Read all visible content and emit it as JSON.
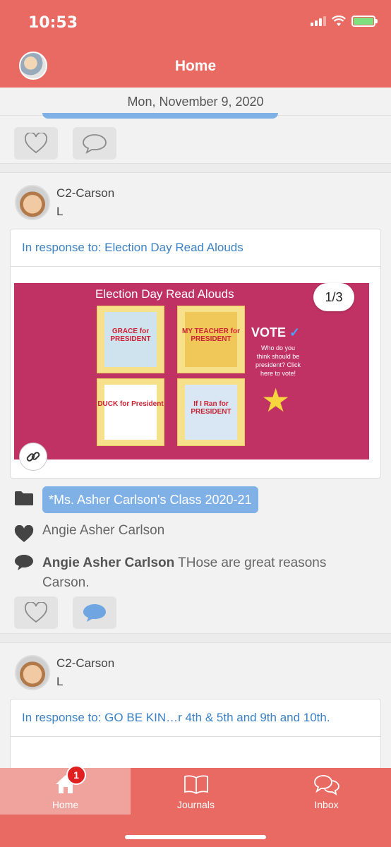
{
  "status": {
    "time": "10:53"
  },
  "header": {
    "title": "Home"
  },
  "date": "Mon, November 9, 2020",
  "posts": [
    {
      "author": "C2-Carson",
      "author_sub": "L",
      "response_to": "In response to: Election Day Read Alouds",
      "image": {
        "title": "Election Day Read Alouds",
        "books": [
          "GRACE for PRESIDENT",
          "MY TEACHER for PRESIDENT",
          "DUCK for President",
          "If I Ran for PRESIDENT"
        ],
        "vote_label": "VOTE",
        "vote_text": "Who do you think should be president? Click here to vote!",
        "counter": "1/3"
      },
      "class_tag": "*Ms. Asher Carlson's Class 2020-21",
      "liked_by": "Angie Asher Carlson",
      "comment": {
        "author": "Angie Asher Carlson",
        "text": "THose are great reasons Carson."
      }
    },
    {
      "author": "C2-Carson",
      "author_sub": "L",
      "response_to": "In response to: GO BE KIN…r 4th & 5th and 9th and 10th."
    }
  ],
  "tabs": [
    {
      "label": "Home",
      "badge": "1",
      "active": true
    },
    {
      "label": "Journals"
    },
    {
      "label": "Inbox"
    }
  ],
  "colors": {
    "brand": "#e96a62",
    "accent_blue": "#7fb0e6",
    "link": "#3b82c4",
    "banner": "#c03263"
  }
}
